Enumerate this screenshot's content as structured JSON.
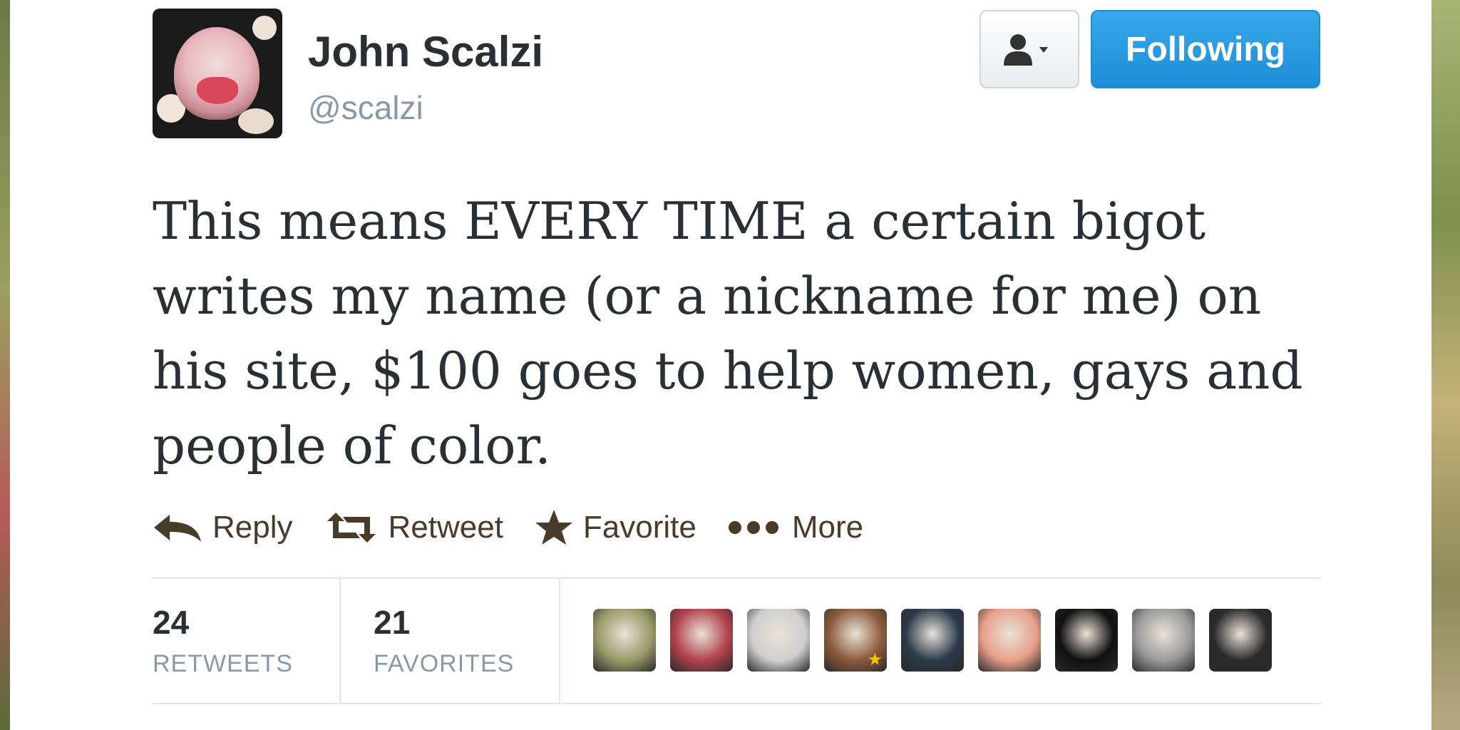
{
  "tweet": {
    "author_name": "John Scalzi",
    "author_handle": "@scalzi",
    "follow_label": "Following",
    "text": "This means EVERY TIME a certain bigot writes my name (or a nickname for me) on his site, $100 goes to help women, gays and people of color."
  },
  "actions": {
    "reply": "Reply",
    "retweet": "Retweet",
    "favorite": "Favorite",
    "more": "More"
  },
  "stats": {
    "retweets_count": "24",
    "retweets_label": "RETWEETS",
    "favorites_count": "21",
    "favorites_label": "FAVORITES"
  },
  "favoriters": [
    {
      "name": "avatar-1",
      "color": "#9a9a6a"
    },
    {
      "name": "avatar-2",
      "color": "#b0424c"
    },
    {
      "name": "avatar-3",
      "color": "#cfcfcf"
    },
    {
      "name": "avatar-4",
      "color": "#8a5a3a"
    },
    {
      "name": "avatar-5",
      "color": "#2a3a4a"
    },
    {
      "name": "avatar-6",
      "color": "#e8a08a"
    },
    {
      "name": "avatar-7",
      "color": "#111111"
    },
    {
      "name": "avatar-8",
      "color": "#9a9a9a"
    },
    {
      "name": "avatar-9",
      "color": "#2a2a2a"
    }
  ],
  "colors": {
    "follow_button": "#1b8ed6",
    "text": "#292f33",
    "muted": "#8899a6"
  }
}
